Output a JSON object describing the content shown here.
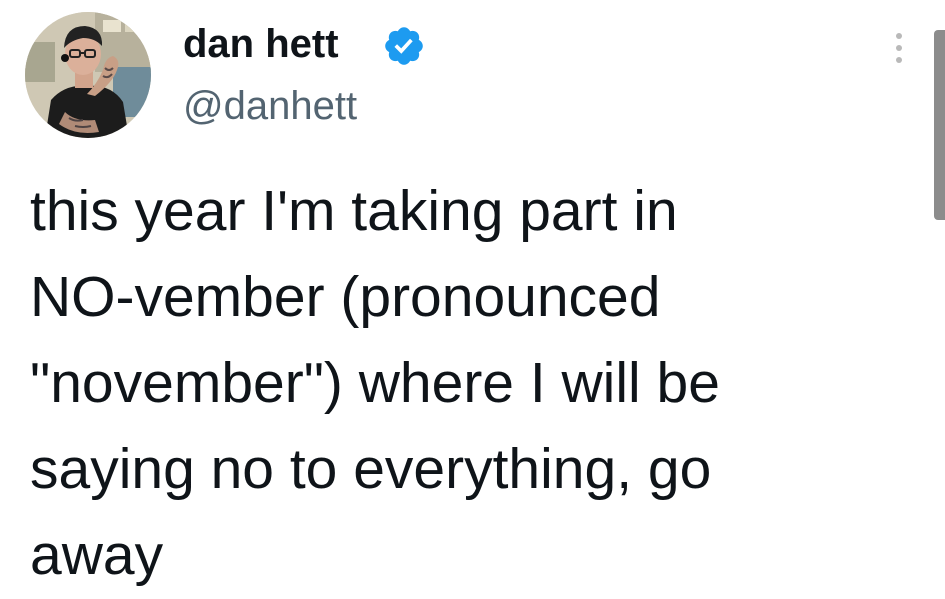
{
  "tweet": {
    "author": {
      "display_name": "dan hett",
      "handle": "@danhett",
      "verified": true,
      "verified_icon": "verified-badge-icon",
      "avatar_icon": "profile-photo"
    },
    "more_icon": "more-options-icon",
    "text": "this year I'm taking part in\nNO-vember (pronounced\n\"november\") where I will be\nsaying no to everything, go\naway"
  },
  "colors": {
    "text_primary": "#0f1419",
    "text_secondary": "#536471",
    "verified_blue": "#1d9bf0",
    "background": "#ffffff"
  }
}
